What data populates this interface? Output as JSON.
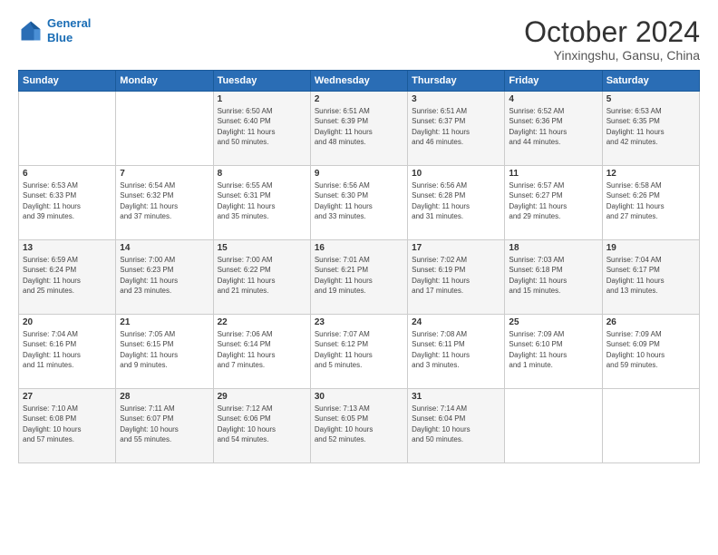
{
  "logo": {
    "line1": "General",
    "line2": "Blue"
  },
  "title": "October 2024",
  "location": "Yinxingshu, Gansu, China",
  "days_of_week": [
    "Sunday",
    "Monday",
    "Tuesday",
    "Wednesday",
    "Thursday",
    "Friday",
    "Saturday"
  ],
  "weeks": [
    [
      {
        "day": "",
        "info": ""
      },
      {
        "day": "",
        "info": ""
      },
      {
        "day": "1",
        "info": "Sunrise: 6:50 AM\nSunset: 6:40 PM\nDaylight: 11 hours\nand 50 minutes."
      },
      {
        "day": "2",
        "info": "Sunrise: 6:51 AM\nSunset: 6:39 PM\nDaylight: 11 hours\nand 48 minutes."
      },
      {
        "day": "3",
        "info": "Sunrise: 6:51 AM\nSunset: 6:37 PM\nDaylight: 11 hours\nand 46 minutes."
      },
      {
        "day": "4",
        "info": "Sunrise: 6:52 AM\nSunset: 6:36 PM\nDaylight: 11 hours\nand 44 minutes."
      },
      {
        "day": "5",
        "info": "Sunrise: 6:53 AM\nSunset: 6:35 PM\nDaylight: 11 hours\nand 42 minutes."
      }
    ],
    [
      {
        "day": "6",
        "info": "Sunrise: 6:53 AM\nSunset: 6:33 PM\nDaylight: 11 hours\nand 39 minutes."
      },
      {
        "day": "7",
        "info": "Sunrise: 6:54 AM\nSunset: 6:32 PM\nDaylight: 11 hours\nand 37 minutes."
      },
      {
        "day": "8",
        "info": "Sunrise: 6:55 AM\nSunset: 6:31 PM\nDaylight: 11 hours\nand 35 minutes."
      },
      {
        "day": "9",
        "info": "Sunrise: 6:56 AM\nSunset: 6:30 PM\nDaylight: 11 hours\nand 33 minutes."
      },
      {
        "day": "10",
        "info": "Sunrise: 6:56 AM\nSunset: 6:28 PM\nDaylight: 11 hours\nand 31 minutes."
      },
      {
        "day": "11",
        "info": "Sunrise: 6:57 AM\nSunset: 6:27 PM\nDaylight: 11 hours\nand 29 minutes."
      },
      {
        "day": "12",
        "info": "Sunrise: 6:58 AM\nSunset: 6:26 PM\nDaylight: 11 hours\nand 27 minutes."
      }
    ],
    [
      {
        "day": "13",
        "info": "Sunrise: 6:59 AM\nSunset: 6:24 PM\nDaylight: 11 hours\nand 25 minutes."
      },
      {
        "day": "14",
        "info": "Sunrise: 7:00 AM\nSunset: 6:23 PM\nDaylight: 11 hours\nand 23 minutes."
      },
      {
        "day": "15",
        "info": "Sunrise: 7:00 AM\nSunset: 6:22 PM\nDaylight: 11 hours\nand 21 minutes."
      },
      {
        "day": "16",
        "info": "Sunrise: 7:01 AM\nSunset: 6:21 PM\nDaylight: 11 hours\nand 19 minutes."
      },
      {
        "day": "17",
        "info": "Sunrise: 7:02 AM\nSunset: 6:19 PM\nDaylight: 11 hours\nand 17 minutes."
      },
      {
        "day": "18",
        "info": "Sunrise: 7:03 AM\nSunset: 6:18 PM\nDaylight: 11 hours\nand 15 minutes."
      },
      {
        "day": "19",
        "info": "Sunrise: 7:04 AM\nSunset: 6:17 PM\nDaylight: 11 hours\nand 13 minutes."
      }
    ],
    [
      {
        "day": "20",
        "info": "Sunrise: 7:04 AM\nSunset: 6:16 PM\nDaylight: 11 hours\nand 11 minutes."
      },
      {
        "day": "21",
        "info": "Sunrise: 7:05 AM\nSunset: 6:15 PM\nDaylight: 11 hours\nand 9 minutes."
      },
      {
        "day": "22",
        "info": "Sunrise: 7:06 AM\nSunset: 6:14 PM\nDaylight: 11 hours\nand 7 minutes."
      },
      {
        "day": "23",
        "info": "Sunrise: 7:07 AM\nSunset: 6:12 PM\nDaylight: 11 hours\nand 5 minutes."
      },
      {
        "day": "24",
        "info": "Sunrise: 7:08 AM\nSunset: 6:11 PM\nDaylight: 11 hours\nand 3 minutes."
      },
      {
        "day": "25",
        "info": "Sunrise: 7:09 AM\nSunset: 6:10 PM\nDaylight: 11 hours\nand 1 minute."
      },
      {
        "day": "26",
        "info": "Sunrise: 7:09 AM\nSunset: 6:09 PM\nDaylight: 10 hours\nand 59 minutes."
      }
    ],
    [
      {
        "day": "27",
        "info": "Sunrise: 7:10 AM\nSunset: 6:08 PM\nDaylight: 10 hours\nand 57 minutes."
      },
      {
        "day": "28",
        "info": "Sunrise: 7:11 AM\nSunset: 6:07 PM\nDaylight: 10 hours\nand 55 minutes."
      },
      {
        "day": "29",
        "info": "Sunrise: 7:12 AM\nSunset: 6:06 PM\nDaylight: 10 hours\nand 54 minutes."
      },
      {
        "day": "30",
        "info": "Sunrise: 7:13 AM\nSunset: 6:05 PM\nDaylight: 10 hours\nand 52 minutes."
      },
      {
        "day": "31",
        "info": "Sunrise: 7:14 AM\nSunset: 6:04 PM\nDaylight: 10 hours\nand 50 minutes."
      },
      {
        "day": "",
        "info": ""
      },
      {
        "day": "",
        "info": ""
      }
    ]
  ]
}
